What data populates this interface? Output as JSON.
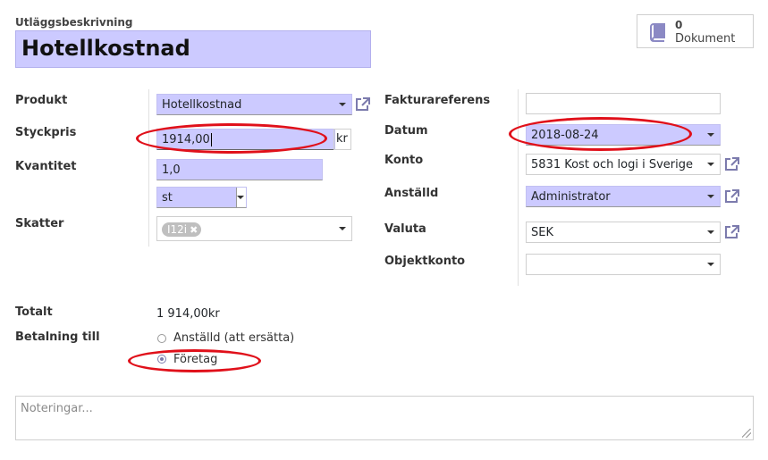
{
  "header": {
    "description_label": "Utläggsbeskrivning",
    "description_value": "Hotellkostnad",
    "documents": {
      "count": "0",
      "label": "Dokument",
      "icon": "book-icon"
    }
  },
  "left": {
    "product": {
      "label": "Produkt",
      "value": "Hotellkostnad"
    },
    "unit_price": {
      "label": "Styckpris",
      "value": "1914,00",
      "suffix": "kr"
    },
    "quantity": {
      "label": "Kvantitet",
      "value": "1,0",
      "uom": "st"
    },
    "taxes": {
      "label": "Skatter",
      "tag": "I12i"
    }
  },
  "right": {
    "invoice_ref": {
      "label": "Fakturareferens",
      "value": ""
    },
    "date": {
      "label": "Datum",
      "value": "2018-08-24"
    },
    "account": {
      "label": "Konto",
      "value": "5831 Kost och logi i Sverige"
    },
    "employee": {
      "label": "Anställd",
      "value": "Administrator"
    },
    "currency": {
      "label": "Valuta",
      "value": "SEK"
    },
    "analytic": {
      "label": "Objektkonto",
      "value": ""
    }
  },
  "summary": {
    "total_label": "Totalt",
    "total_value": "1 914,00kr",
    "payment_label": "Betalning till",
    "options": [
      "Anställd (att ersätta)",
      "Företag"
    ],
    "selected": "Företag"
  },
  "notes": {
    "placeholder": "Noteringar..."
  },
  "colors": {
    "required_bg": "#cccaff",
    "highlight_ring": "#e0101a",
    "accent": "#7c7bad"
  }
}
